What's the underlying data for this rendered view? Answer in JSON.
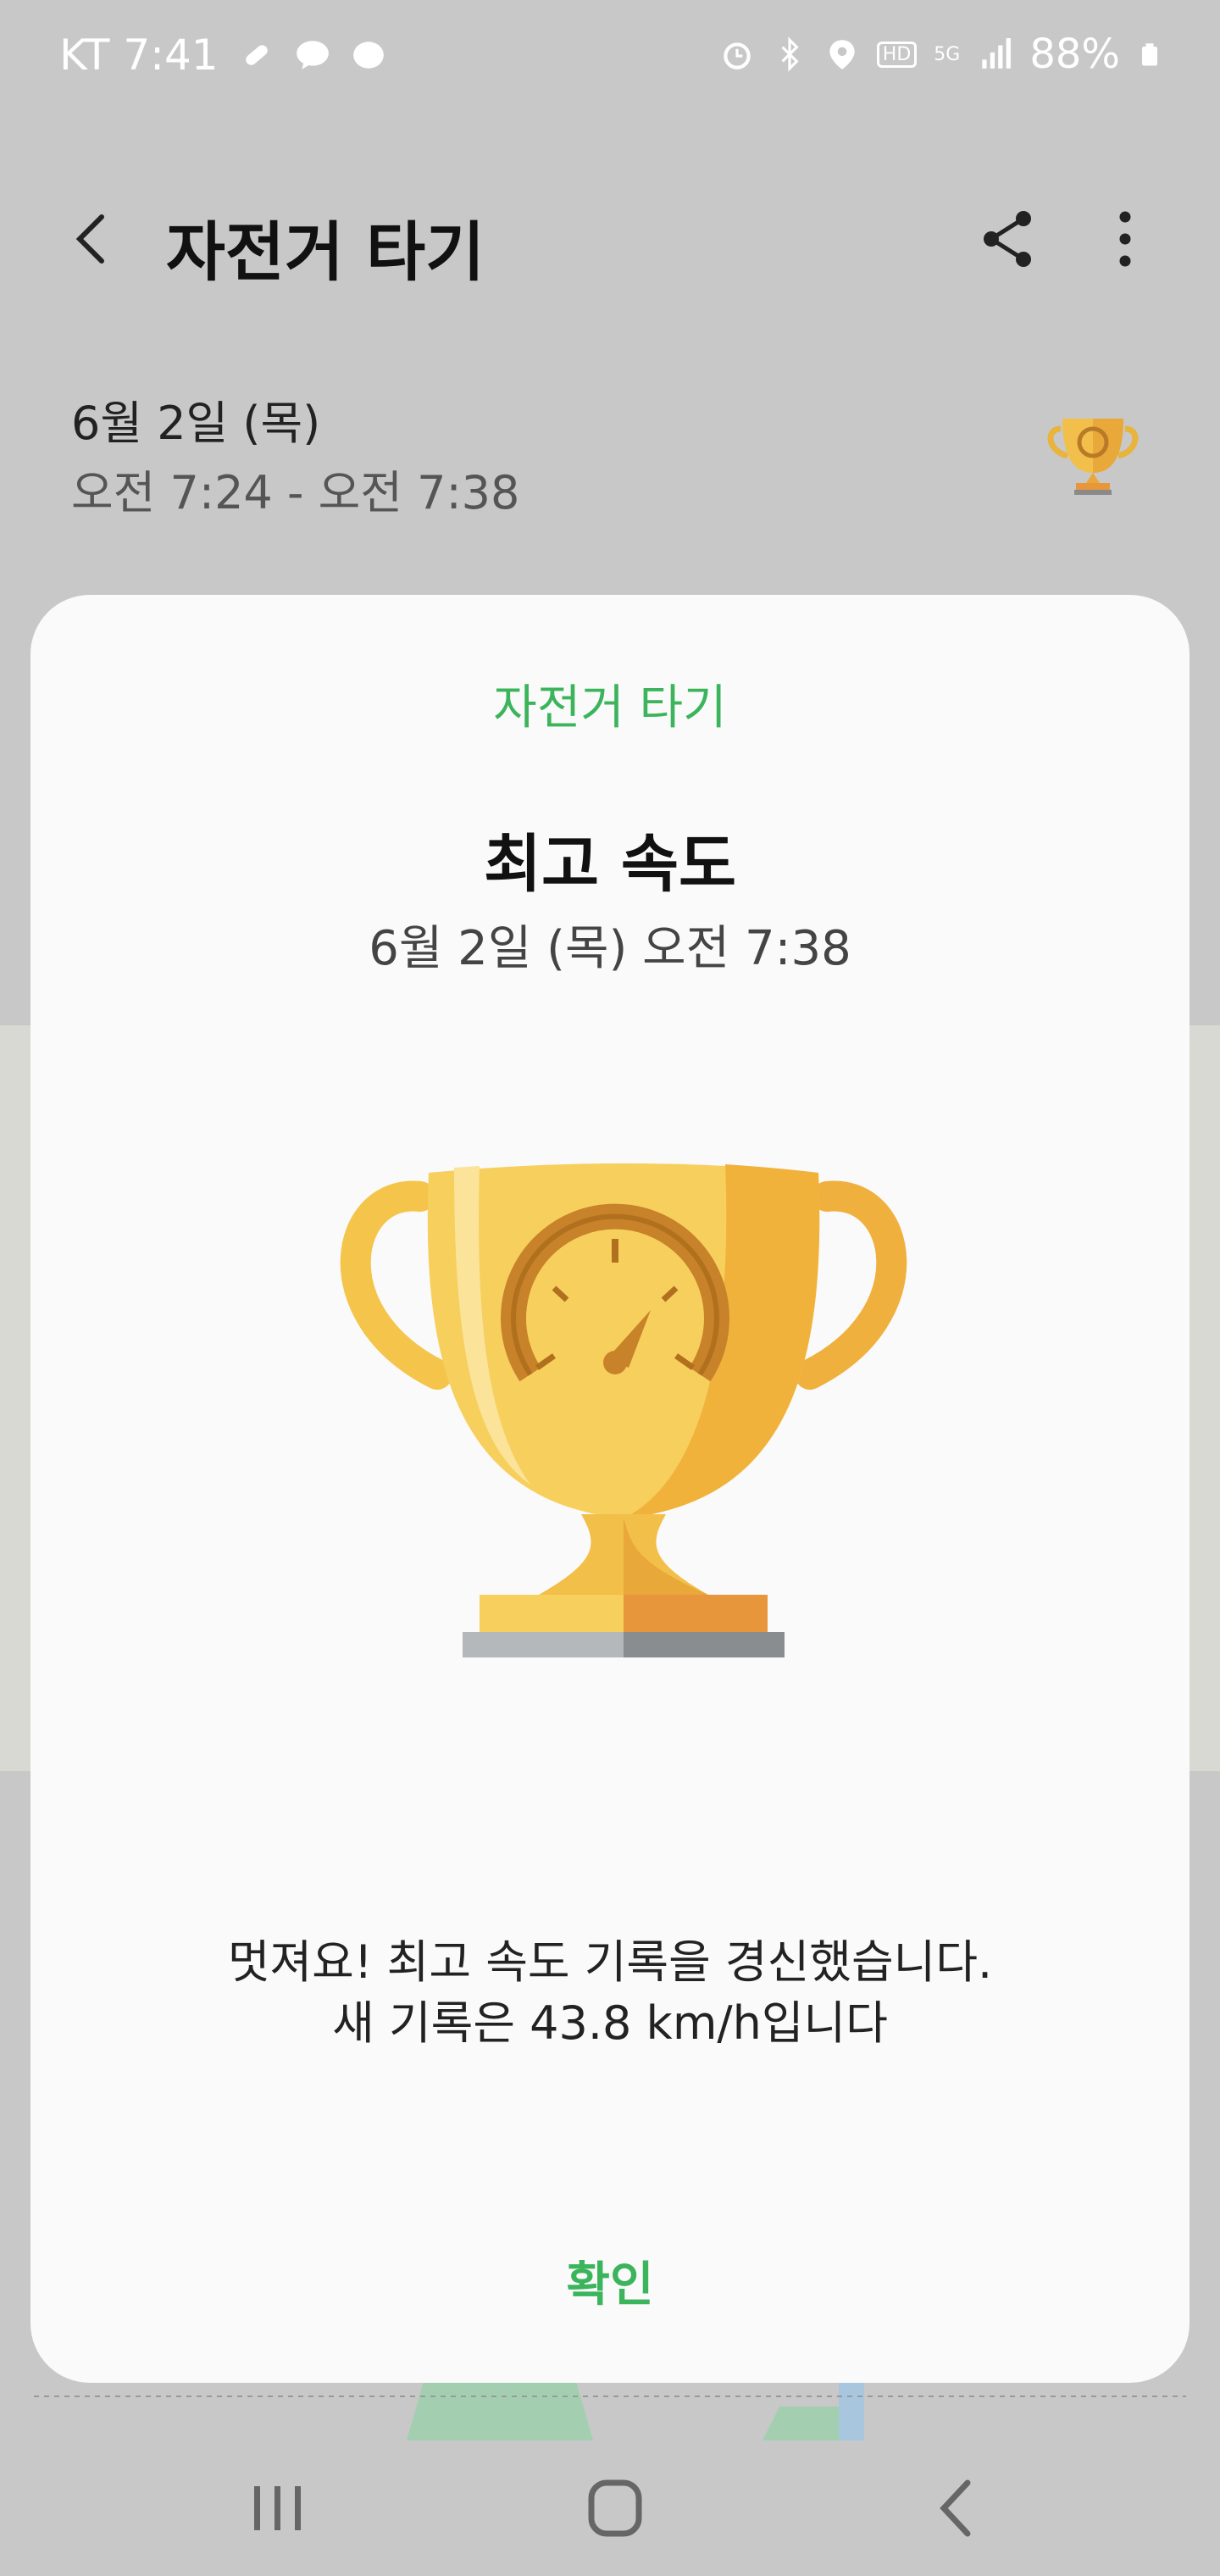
{
  "status_bar": {
    "carrier_time": "KT 7:41",
    "battery": "88%",
    "network_badges": [
      "HD",
      "5G"
    ]
  },
  "header": {
    "title": "자전거 타기"
  },
  "workout": {
    "date": "6월 2일 (목)",
    "time_range": "오전 7:24 - 오전 7:38"
  },
  "dialog": {
    "category": "자전거 타기",
    "title": "최고 속도",
    "datetime": "6월 2일 (목) 오전 7:38",
    "message_line1": "멋져요! 최고 속도 기록을 경신했습니다.",
    "message_line2": "새 기록은 43.8 km/h입니다",
    "confirm_label": "확인"
  },
  "colors": {
    "accent": "#3cb45c",
    "trophy_gold": "#f7cb4d",
    "trophy_orange": "#e8963c"
  },
  "icons": [
    "back-icon",
    "share-icon",
    "more-icon",
    "trophy-icon",
    "recents-icon",
    "home-icon",
    "nav-back-icon"
  ]
}
